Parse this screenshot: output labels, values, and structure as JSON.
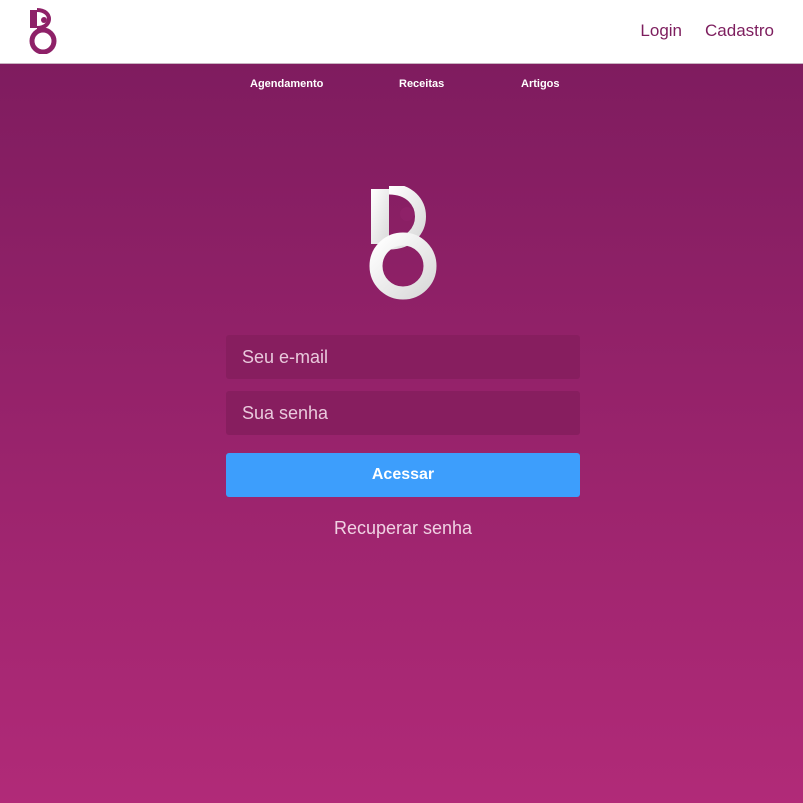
{
  "header": {
    "logo_icon": "brand-logo-icon",
    "login_label": "Login",
    "signup_label": "Cadastro"
  },
  "subnav": {
    "items": [
      {
        "label": "Agendamento"
      },
      {
        "label": "Receitas"
      },
      {
        "label": "Artigos"
      }
    ]
  },
  "login_form": {
    "logo_icon": "brand-logo-icon",
    "email_placeholder": "Seu e-mail",
    "email_value": "",
    "password_placeholder": "Sua senha",
    "password_value": "",
    "submit_label": "Acessar",
    "recover_label": "Recuperar senha"
  },
  "colors": {
    "brand": "#7d1e5e",
    "background_top": "#7f1c5f",
    "background_bottom": "#b12a78",
    "field_bg": "#871e5f",
    "button": "#3d9efc"
  }
}
